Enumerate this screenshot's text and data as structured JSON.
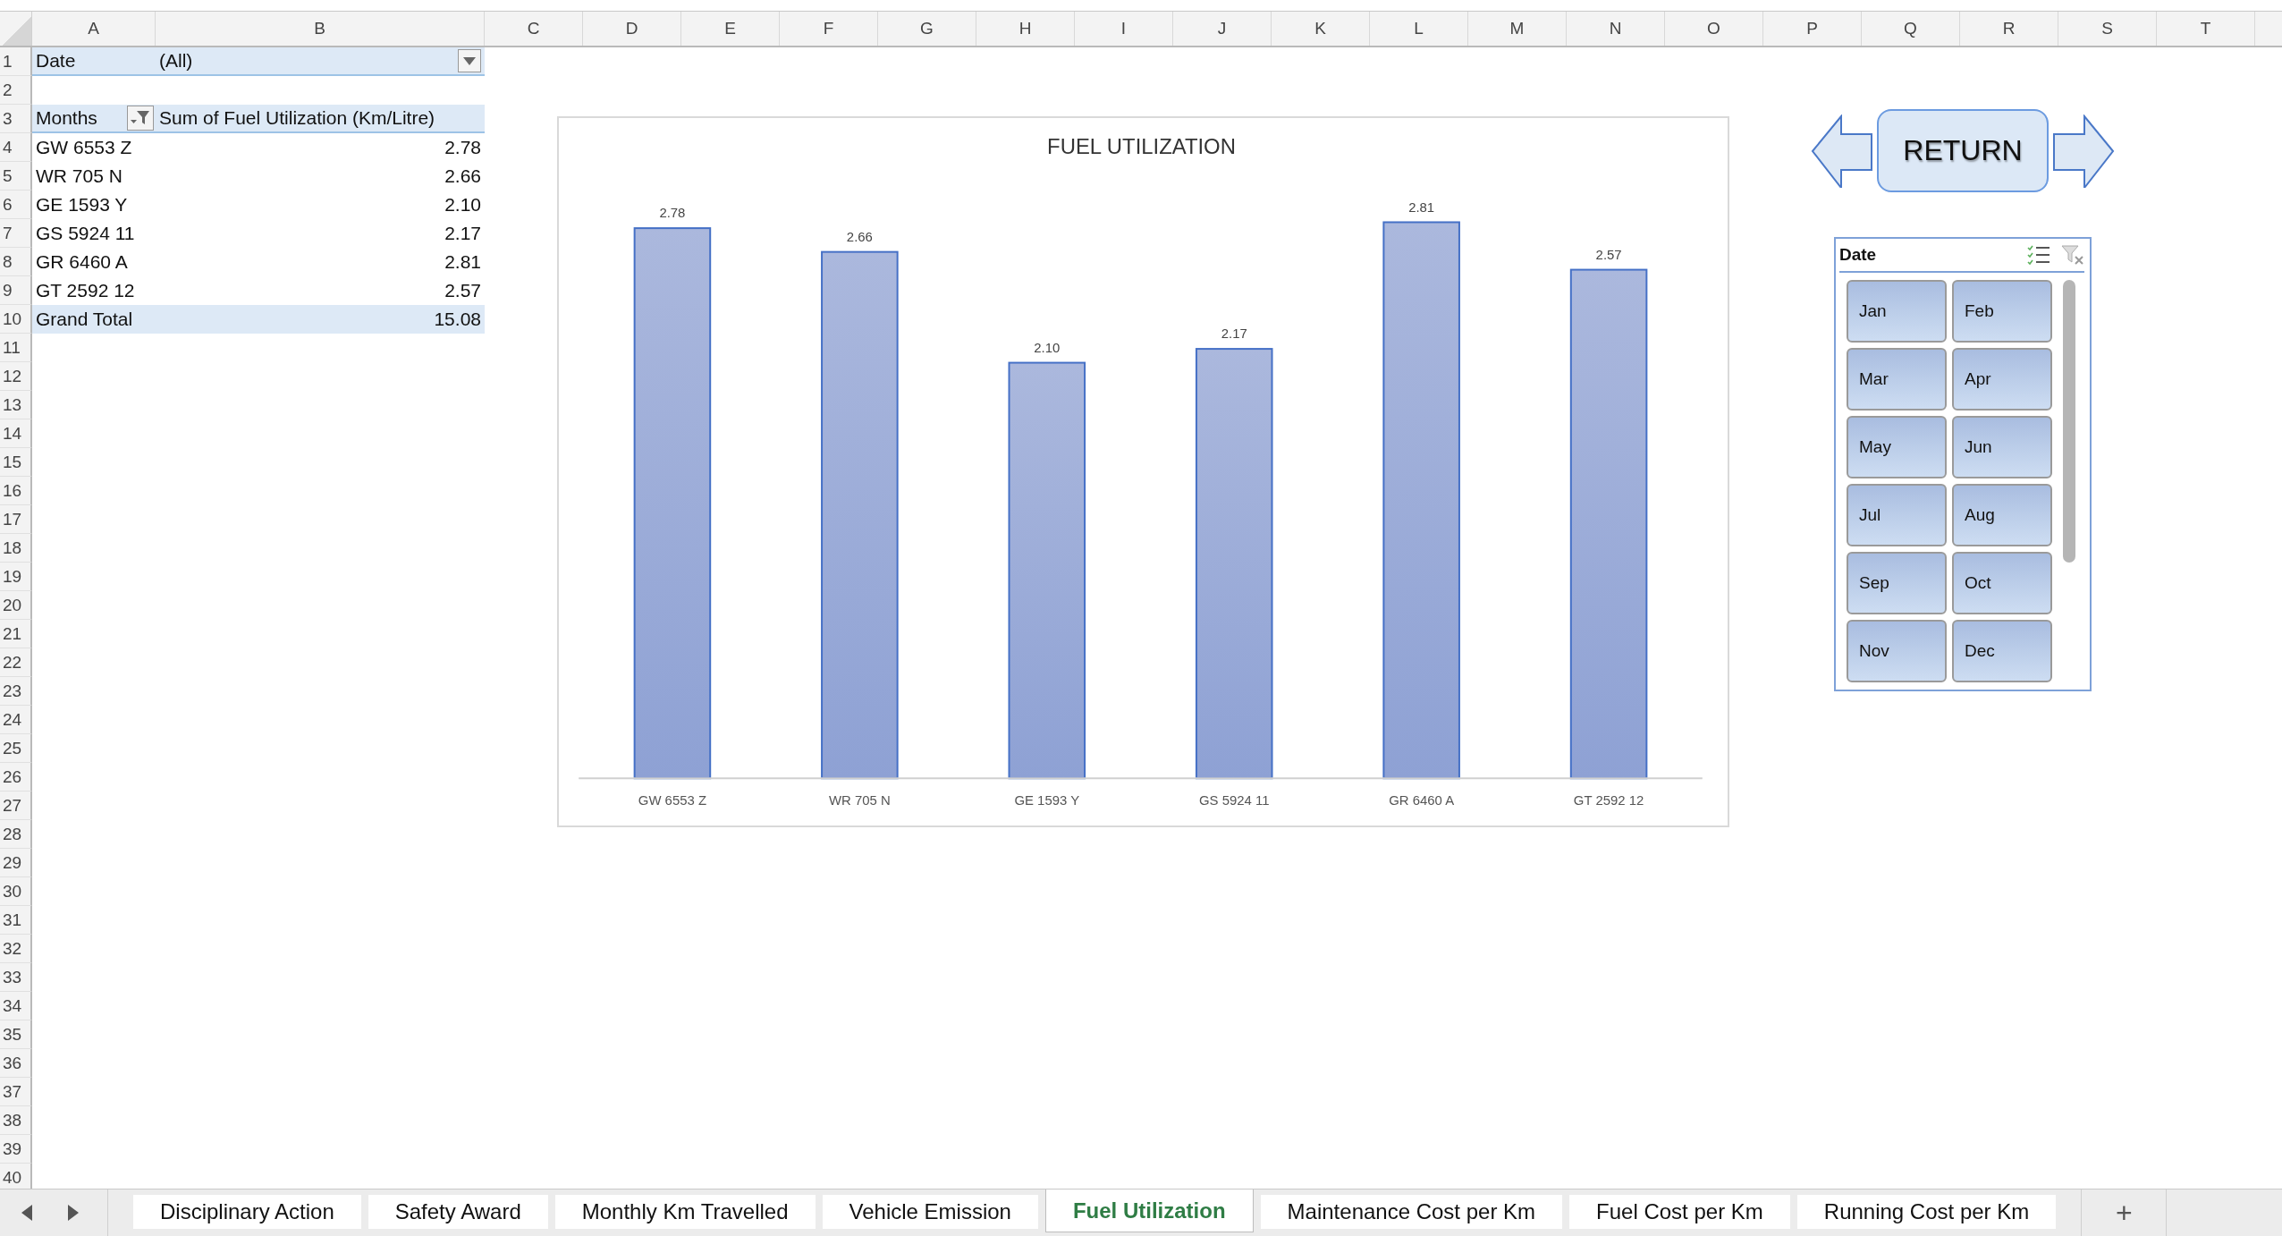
{
  "column_headers": [
    "A",
    "B",
    "C",
    "D",
    "E",
    "F",
    "G",
    "H",
    "I",
    "J",
    "K",
    "L",
    "M",
    "N",
    "O",
    "P",
    "Q",
    "R",
    "S",
    "T"
  ],
  "row_numbers": [
    "1",
    "2",
    "3",
    "4",
    "5",
    "6",
    "7",
    "8",
    "9",
    "10",
    "11",
    "12",
    "13",
    "14",
    "15",
    "16",
    "17",
    "18",
    "19",
    "20",
    "21",
    "22",
    "23",
    "24",
    "25",
    "26",
    "27",
    "28",
    "29",
    "30",
    "31",
    "32",
    "33",
    "34",
    "35",
    "36",
    "37",
    "38",
    "39",
    "40"
  ],
  "pivot": {
    "filter": {
      "label": "Date",
      "value": "(All)"
    },
    "header": {
      "row_label": "Months",
      "value_label": "Sum of Fuel Utilization (Km/Litre)"
    },
    "rows": [
      {
        "label": "GW 6553 Z",
        "value": "2.78"
      },
      {
        "label": "WR 705 N",
        "value": "2.66"
      },
      {
        "label": "GE 1593 Y",
        "value": "2.10"
      },
      {
        "label": "GS 5924 11",
        "value": "2.17"
      },
      {
        "label": "GR 6460 A",
        "value": "2.81"
      },
      {
        "label": "GT 2592 12",
        "value": "2.57"
      }
    ],
    "total": {
      "label": "Grand Total",
      "value": "15.08"
    }
  },
  "chart": {
    "chart_data": {
      "type": "bar",
      "title": "FUEL UTILIZATION",
      "categories": [
        "GW 6553 Z",
        "WR 705 N",
        "GE 1593 Y",
        "GS 5924 11",
        "GR 6460 A",
        "GT 2592 12"
      ],
      "values": [
        2.78,
        2.66,
        2.1,
        2.17,
        2.81,
        2.57
      ],
      "value_labels": [
        "2.78",
        "2.66",
        "2.10",
        "2.17",
        "2.81",
        "2.57"
      ],
      "data_labels": true
    }
  },
  "return_button": {
    "label": "RETURN"
  },
  "slicer": {
    "title": "Date",
    "items": [
      {
        "label": "Jan",
        "selected": true
      },
      {
        "label": "Feb",
        "selected": true
      },
      {
        "label": "Mar",
        "selected": true
      },
      {
        "label": "Apr",
        "selected": true
      },
      {
        "label": "May",
        "selected": true
      },
      {
        "label": "Jun",
        "selected": true
      },
      {
        "label": "Jul",
        "selected": true
      },
      {
        "label": "Aug",
        "selected": true
      },
      {
        "label": "Sep",
        "selected": true
      },
      {
        "label": "Oct",
        "selected": true
      },
      {
        "label": "Nov",
        "selected": true
      },
      {
        "label": "Dec",
        "selected": true
      }
    ]
  },
  "sheet_tabs": [
    {
      "label": "Disciplinary Action",
      "selected": false
    },
    {
      "label": "Safety Award",
      "selected": false
    },
    {
      "label": "Monthly Km Travelled",
      "selected": false
    },
    {
      "label": "Vehicle Emission",
      "selected": false
    },
    {
      "label": "Fuel Utilization",
      "selected": true
    },
    {
      "label": "Maintenance Cost per Km",
      "selected": false
    },
    {
      "label": "Fuel Cost per Km",
      "selected": false
    },
    {
      "label": "Running Cost per Km",
      "selected": false
    }
  ],
  "add_sheet": {
    "label": "+"
  }
}
